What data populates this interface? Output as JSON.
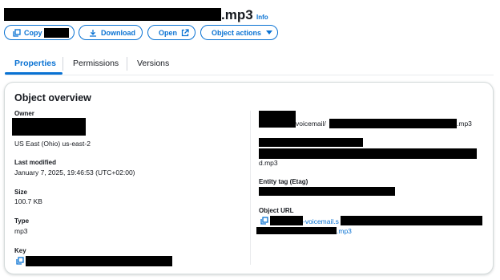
{
  "header": {
    "title_suffix": ".mp3",
    "info_label": "Info"
  },
  "toolbar": {
    "copy_label": "Copy",
    "download_label": "Download",
    "open_label": "Open",
    "object_actions_label": "Object actions"
  },
  "tabs": [
    {
      "label": "Properties",
      "active": true
    },
    {
      "label": "Permissions",
      "active": false
    },
    {
      "label": "Versions",
      "active": false
    }
  ],
  "overview": {
    "title": "Object overview",
    "owner_label": "Owner",
    "region_value": "US East (Ohio) us-east-2",
    "last_modified_label": "Last modified",
    "last_modified_value": "January 7, 2025, 19:46:53 (UTC+02:00)",
    "size_label": "Size",
    "size_value": "100.7 KB",
    "type_label": "Type",
    "type_value": "mp3",
    "key_label": "Key",
    "s3_uri_mid": "voicemail/",
    "s3_uri_end": ".mp3",
    "arn_end": "d.mp3",
    "etag_label": "Entity tag (Etag)",
    "object_url_label": "Object URL",
    "object_url_mid": "-voicemail.s",
    "object_url_end": ".mp3"
  },
  "colors": {
    "accent": "#0972d3",
    "text": "#16191f",
    "redaction": "#000000"
  }
}
